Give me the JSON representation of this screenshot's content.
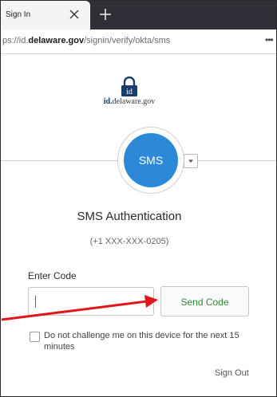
{
  "browser": {
    "tab_title": "Sign In",
    "close_icon": "close-icon",
    "new_tab_icon": "plus-icon",
    "url_prefix": "ps://id.",
    "url_domain": "delaware.gov",
    "url_path": "/signin/verify/okta/sms",
    "menu": "•••"
  },
  "brand": {
    "logo_icon": "padlock-id-icon",
    "name_bold": "id.",
    "name_rest": "delaware.gov",
    "color": "#1c3d69"
  },
  "factor": {
    "badge": "SMS",
    "badge_color": "#2b89d8",
    "dropdown_icon": "caret-down-icon"
  },
  "form": {
    "title": "SMS Authentication",
    "phone": "(+1 XXX-XXX-0205)",
    "code_label": "Enter Code",
    "code_value": "",
    "send_button": "Send Code",
    "send_button_color": "#2e8a3a",
    "remember_label": "Do not challenge me on this device for the next 15 minutes",
    "remember_checked": false,
    "sign_out": "Sign Out"
  },
  "annotation": {
    "arrow_color": "#e0161b"
  }
}
